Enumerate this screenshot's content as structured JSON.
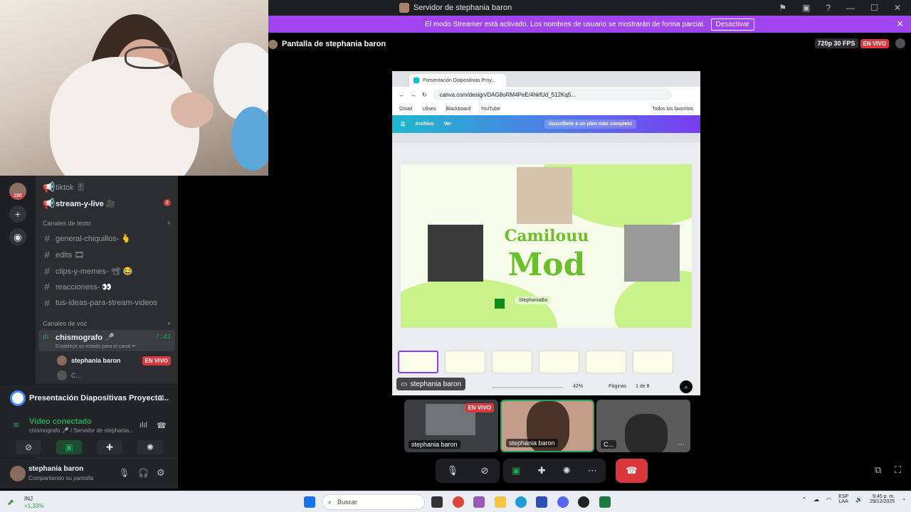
{
  "window": {
    "title": "Servidor de stephania baron"
  },
  "banner": {
    "text": "El modo Streamer está activado. Los nombres de usuario se mostrarán de forma parcial.",
    "button": "Desactivar"
  },
  "stream": {
    "title": "Pantalla de stephania baron",
    "quality": "720p 30 FPS",
    "live": "EN VIVO"
  },
  "server_rail": {
    "badge": "180"
  },
  "channels": {
    "top": [
      {
        "label": "tiktok 🎚"
      },
      {
        "label": "stream-y-live 🎥"
      }
    ],
    "stream_mentions": "2",
    "text_category": "Canales de texto",
    "text": [
      "general-chiquillos- 🫰",
      "edits 🎞",
      "clips-y-memes- 📽 😂",
      "reaccioness- 👀",
      "tus-ideas-para-stream-videos"
    ],
    "voice_category": "Canales de voz",
    "voice_channel": {
      "name": "chismografo 🎤",
      "time": "7:42",
      "status": "Establece un estado para el canal ✏"
    },
    "voice_users": [
      {
        "name": "stephania baron",
        "live": "EN VIVO"
      },
      {
        "name": "C..."
      }
    ]
  },
  "voice_panel": {
    "activity": "Presentación Diapositivas Proyecto...",
    "connected": "Video conectado",
    "location": "chismografo 🎤 / Servidor de stephania..."
  },
  "user": {
    "name": "stephania baron",
    "status": "Compartiendo su pantalla"
  },
  "browser": {
    "tab": "Presentación Diapositivas Proy...",
    "url": "canva.com/design/DAG8oRM4PeE/4hkfUd_512Kq5...",
    "bookmarks": [
      "Gmail",
      "Ulises",
      "Blackboard",
      "YouTube"
    ],
    "bookmarks_all": "Todos los favoritos",
    "canva_menu": [
      "Archivo",
      "Ver"
    ],
    "canva_promo": "Suscríbete a un plan más completo",
    "slide_title1": "Camilouu",
    "slide_title2": "Mod",
    "slide_chip": "StephaniaBa",
    "zoom": "42%",
    "pages_label": "Páginas",
    "pages": "1 de 8"
  },
  "share_label": "stephania baron",
  "tiles": [
    {
      "label": "stephania baron",
      "live": "EN VIVO"
    },
    {
      "label": "stephania baron"
    },
    {
      "label": "C..."
    }
  ],
  "taskbar": {
    "weather_temp": "INJ",
    "weather_change": "+1,33%",
    "search": "Buscar",
    "lang1": "ESP",
    "lang2": "LAA",
    "time": "9:45 p. m.",
    "date": "29/12/2025"
  }
}
